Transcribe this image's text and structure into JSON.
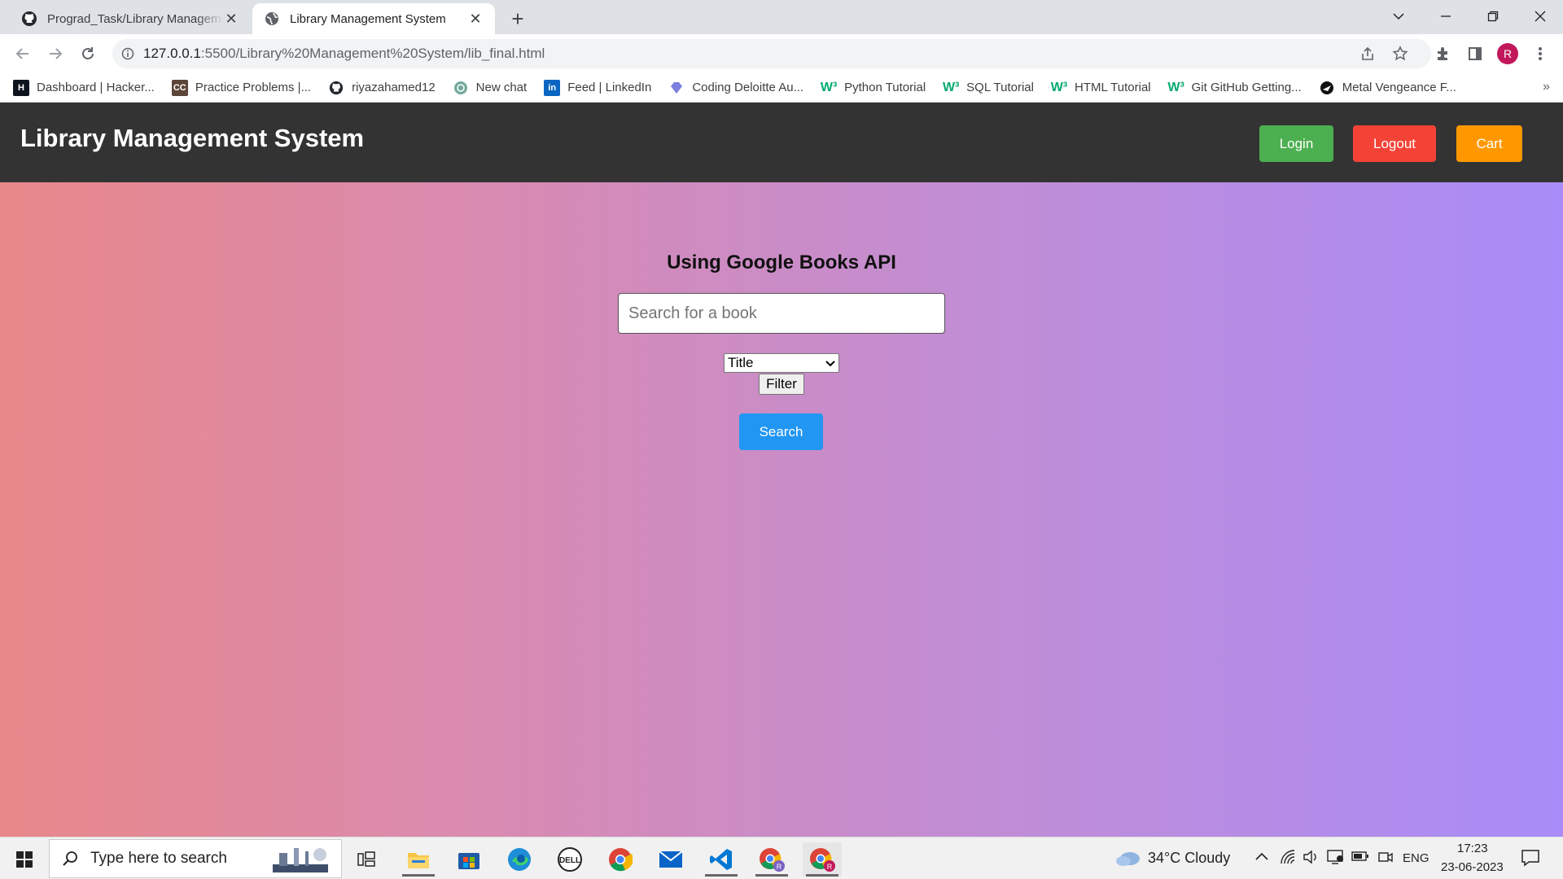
{
  "browser": {
    "tabs": [
      {
        "title": "Prograd_Task/Library Management",
        "icon": "github-icon",
        "active": false
      },
      {
        "title": "Library Management System",
        "icon": "globe-icon",
        "active": true
      }
    ],
    "url_host": "127.0.0.1",
    "url_path": ":5500/Library%20Management%20System/lib_final.html",
    "bookmarks": [
      {
        "label": "Dashboard | Hacker...",
        "icon": "hackerrank-icon"
      },
      {
        "label": "Practice Problems |...",
        "icon": "codechef-icon"
      },
      {
        "label": "riyazahamed12",
        "icon": "github-icon"
      },
      {
        "label": "New chat",
        "icon": "openai-icon"
      },
      {
        "label": "Feed | LinkedIn",
        "icon": "linkedin-icon"
      },
      {
        "label": "Coding Deloitte Au...",
        "icon": "diamond-icon"
      },
      {
        "label": "Python Tutorial",
        "icon": "w3schools-icon"
      },
      {
        "label": "SQL Tutorial",
        "icon": "w3schools-icon"
      },
      {
        "label": "HTML Tutorial",
        "icon": "w3schools-icon"
      },
      {
        "label": "Git GitHub Getting...",
        "icon": "w3schools-icon"
      },
      {
        "label": "Metal Vengeance F...",
        "icon": "game-icon"
      }
    ],
    "profile_initial": "R"
  },
  "page": {
    "title": "Library Management System",
    "login_label": "Login",
    "logout_label": "Logout",
    "cart_label": "Cart",
    "api_heading": "Using Google Books API",
    "search_placeholder": "Search for a book",
    "filter_selected": "Title",
    "filter_button": "Filter",
    "search_button": "Search",
    "colors": {
      "header_bg": "#333333",
      "login": "#4caf50",
      "logout": "#f44336",
      "cart": "#ff9800",
      "search": "#2196f3",
      "gradient_start": "#e8888a",
      "gradient_end": "#a98cf8"
    }
  },
  "taskbar": {
    "search_placeholder": "Type here to search",
    "weather": "34°C  Cloudy",
    "language": "ENG",
    "time": "17:23",
    "date": "23-06-2023"
  }
}
